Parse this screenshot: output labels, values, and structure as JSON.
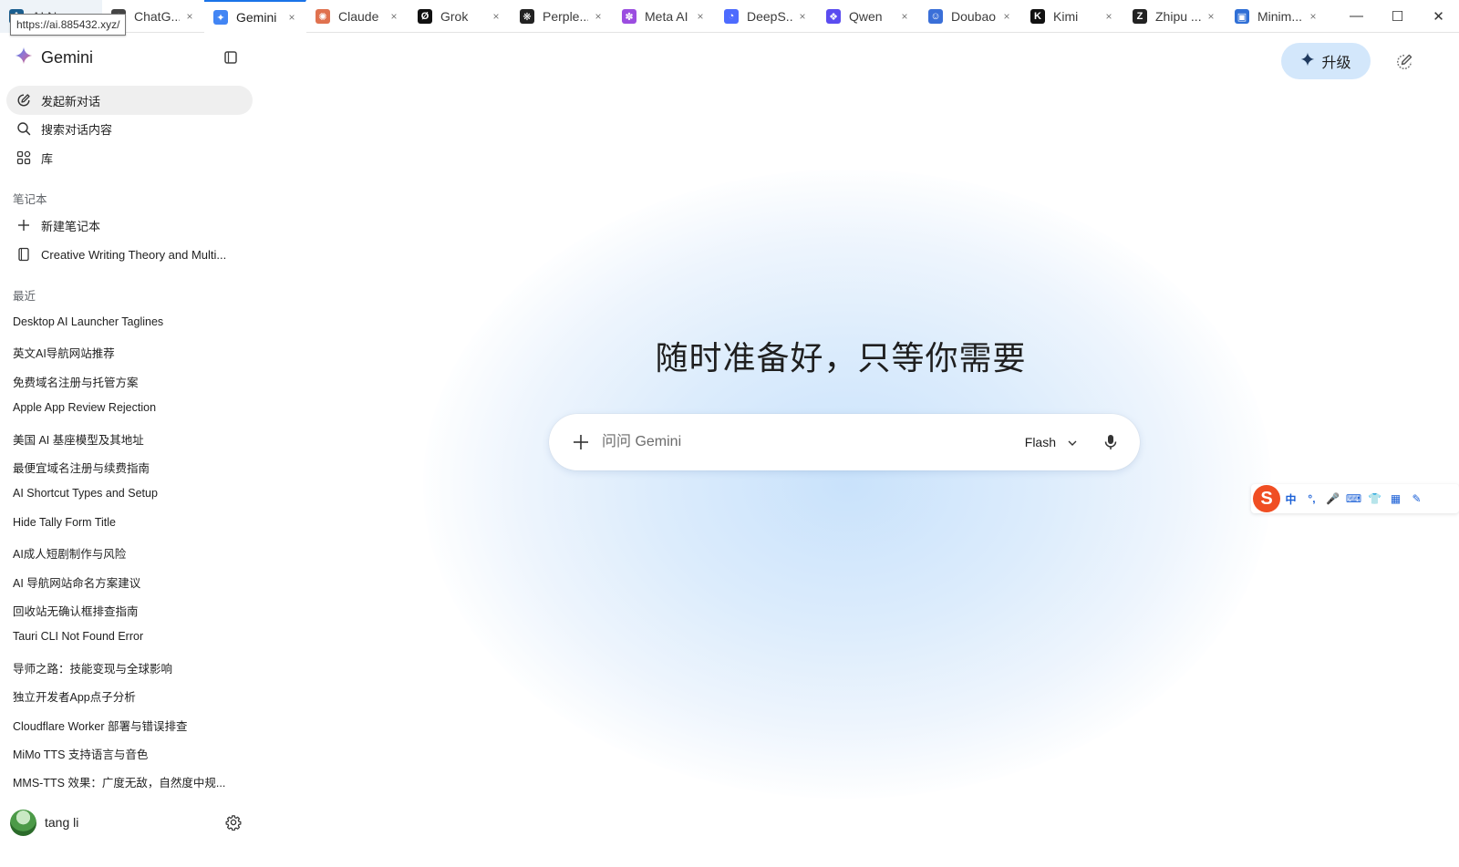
{
  "browser": {
    "tabs": [
      {
        "label": "AI Na...",
        "icon": "ai-nav-icon",
        "color": "#1b5e8f"
      },
      {
        "label": "ChatG...",
        "icon": "chatgpt-icon",
        "color": "#444444"
      },
      {
        "label": "Gemini",
        "icon": "gemini-icon",
        "color": "#4285f4"
      },
      {
        "label": "Claude",
        "icon": "claude-icon",
        "color": "#e0724f"
      },
      {
        "label": "Grok",
        "icon": "grok-icon",
        "color": "#111111"
      },
      {
        "label": "Perple...",
        "icon": "perplexity-icon",
        "color": "#222222"
      },
      {
        "label": "Meta AI",
        "icon": "meta-ai-icon",
        "color": "#9b4de0"
      },
      {
        "label": "DeepS...",
        "icon": "deepseek-icon",
        "color": "#4d6bfe"
      },
      {
        "label": "Qwen",
        "icon": "qwen-icon",
        "color": "#5b4cf0"
      },
      {
        "label": "Doubao",
        "icon": "doubao-icon",
        "color": "#3a6fd8"
      },
      {
        "label": "Kimi",
        "icon": "kimi-icon",
        "color": "#111111"
      },
      {
        "label": "Zhipu ...",
        "icon": "zhipu-icon",
        "color": "#222222"
      },
      {
        "label": "Minim...",
        "icon": "minimax-icon",
        "color": "#2f6fd6"
      }
    ],
    "tab_close_glyph": "×",
    "url_tooltip": "https://ai.885432.xyz/",
    "window": {
      "minimize": "—",
      "maximize": "☐",
      "close": "✕"
    }
  },
  "sidebar": {
    "brand": "Gemini",
    "nav": {
      "new_chat": "发起新对话",
      "search": "搜索对话内容",
      "library": "库"
    },
    "notebooks": {
      "title": "笔记本",
      "new_notebook": "新建笔记本",
      "items": [
        "Creative Writing Theory and Multi..."
      ]
    },
    "recent": {
      "title": "最近",
      "items": [
        "Desktop AI Launcher Taglines",
        "英文AI导航网站推荐",
        "免费域名注册与托管方案",
        "Apple App Review Rejection",
        "美国 AI 基座模型及其地址",
        "最便宜域名注册与续费指南",
        "AI Shortcut Types and Setup",
        "Hide Tally Form Title",
        "AI成人短剧制作与风险",
        "AI 导航网站命名方案建议",
        "回收站无确认框排查指南",
        "Tauri CLI Not Found Error",
        "导师之路：技能变现与全球影响",
        "独立开发者App点子分析",
        "Cloudflare Worker 部署与错误排查",
        "MiMo TTS 支持语言与音色",
        "MMS-TTS 效果：广度无敌，自然度中规..."
      ]
    },
    "user": {
      "name": "tang li"
    }
  },
  "main": {
    "upgrade_label": "升级",
    "hero": "随时准备好，只等你需要",
    "prompt": {
      "placeholder": "问问 Gemini",
      "value": "",
      "model": "Flash"
    }
  },
  "ime": {
    "items": [
      "中",
      "°,",
      "🎤",
      "⌨",
      "👕",
      "▦",
      "✎"
    ]
  },
  "colors": {
    "accent": "#1a73e8",
    "upgrade_bg": "#d3e7fb",
    "selected_nav_bg": "#efefef"
  }
}
